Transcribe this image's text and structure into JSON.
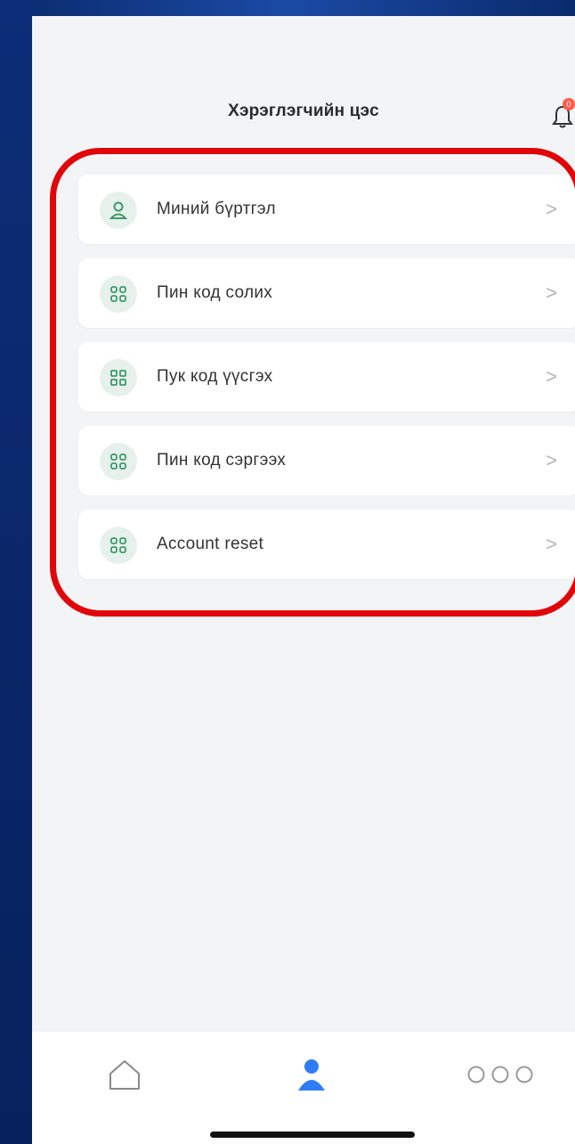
{
  "header": {
    "title": "Хэрэглэгчийн цэс",
    "notification_badge": "0"
  },
  "menu": {
    "items": [
      {
        "label": "Миний бүртгэл",
        "icon": "user-icon"
      },
      {
        "label": "Пин код солих",
        "icon": "grid-icon"
      },
      {
        "label": "Пук код үүсгэх",
        "icon": "grid-icon"
      },
      {
        "label": "Пин код сэргээх",
        "icon": "grid-icon"
      },
      {
        "label": "Account reset",
        "icon": "grid-icon"
      }
    ],
    "chevron": ">"
  },
  "tabbar": {
    "tabs": [
      {
        "icon": "home-icon",
        "active": false
      },
      {
        "icon": "profile-icon",
        "active": true
      },
      {
        "icon": "more-icon",
        "active": false
      }
    ]
  },
  "colors": {
    "accent": "#2f7df4",
    "icon_green": "#3c9a6b",
    "highlight_red": "#e0060a"
  }
}
